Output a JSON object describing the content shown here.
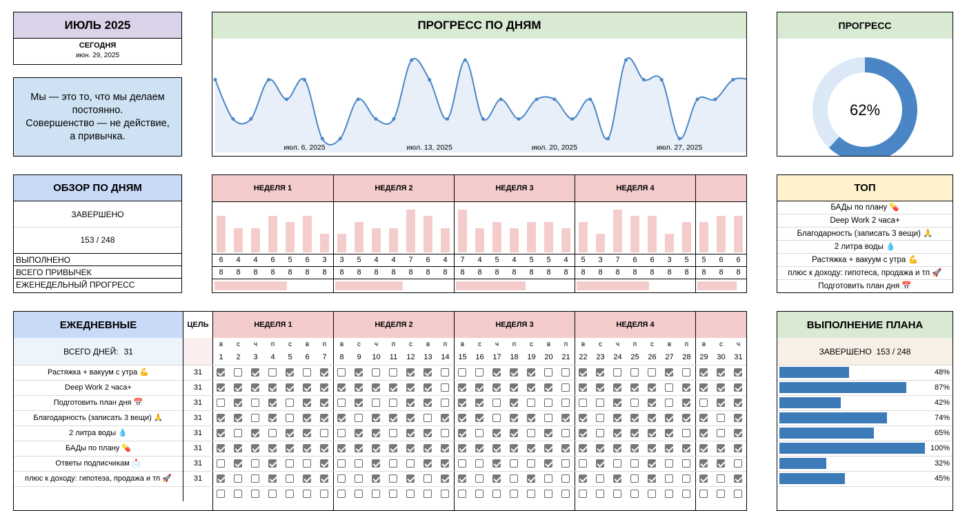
{
  "month": {
    "title": "ИЮЛЬ 2025",
    "today_label": "СЕГОДНЯ",
    "today_date": "июн. 29, 2025"
  },
  "quote": {
    "line1": "Мы — это то, что мы делаем",
    "line2": "постоянно.",
    "line3": "Совершенство — не действие,",
    "line4": "а привычка."
  },
  "progress_chart": {
    "title": "ПРОГРЕСС ПО ДНЯМ",
    "x_ticks": [
      "июл. 6, 2025",
      "июл. 13, 2025",
      "июл. 20, 2025",
      "июл. 27, 2025"
    ]
  },
  "progress": {
    "title": "ПРОГРЕСС",
    "percent_label": "62%",
    "value": 0.62
  },
  "overview": {
    "title": "ОБЗОР ПО ДНЯМ",
    "completed_label": "ЗАВЕРШЕНО",
    "completed_value": "153 / 248",
    "row_done": "ВЫПОЛНЕНО",
    "row_total": "ВСЕГО ПРИВЫЧЕК",
    "row_weekly": "ЕЖЕНЕДЕЛЬНЫЙ ПРОГРЕСС"
  },
  "weeks": [
    "НЕДЕЛЯ 1",
    "НЕДЕЛЯ 2",
    "НЕДЕЛЯ 3",
    "НЕДЕЛЯ 4"
  ],
  "chart_data": {
    "type": "line",
    "x": [
      1,
      2,
      3,
      4,
      5,
      6,
      7,
      8,
      9,
      10,
      11,
      12,
      13,
      14,
      15,
      16,
      17,
      18,
      19,
      20,
      21,
      22,
      23,
      24,
      25,
      26,
      27,
      28,
      29,
      30,
      31
    ],
    "values": [
      6,
      4,
      4,
      6,
      5,
      6,
      3,
      3,
      5,
      4,
      4,
      7,
      6,
      4,
      7,
      4,
      5,
      4,
      5,
      5,
      4,
      5,
      3,
      7,
      6,
      6,
      3,
      5,
      5,
      6,
      6
    ],
    "totals": [
      8,
      8,
      8,
      8,
      8,
      8,
      8,
      8,
      8,
      8,
      8,
      8,
      8,
      8,
      8,
      8,
      8,
      8,
      8,
      8,
      8,
      8,
      8,
      8,
      8,
      8,
      8,
      8,
      8,
      8,
      8
    ],
    "weekly_progress": [
      0.61,
      0.57,
      0.59,
      0.61,
      0.58
    ]
  },
  "top": {
    "title": "ТОП",
    "items": [
      "БАДы по плану 💊",
      "Deep Work 2 часа+",
      "Благодарность (записать 3 вещи) 🙏",
      "2 литра воды 💧",
      "Растяжка + вакуум с утра 💪",
      "плюс к доходу: гипотеса, продажа и тп 🚀",
      "Подготовить план дня 📅"
    ]
  },
  "daily": {
    "title": "ЕЖЕДНЕВНЫЕ",
    "goal_label": "ЦЕЛЬ",
    "total_days_label": "ВСЕГО ДНЕЙ:",
    "total_days_value": "31",
    "weekdays": [
      "в",
      "с",
      "ч",
      "п",
      "с",
      "в",
      "п",
      "в",
      "с",
      "ч",
      "п",
      "с",
      "в",
      "п",
      "в",
      "с",
      "ч",
      "п",
      "с",
      "в",
      "п",
      "в",
      "с",
      "ч",
      "п",
      "с",
      "в",
      "п",
      "в",
      "с",
      "ч"
    ],
    "habits": [
      {
        "name": "Растяжка + вакуум с утра 💪",
        "goal": "31",
        "pct": "48%",
        "frac": 0.48,
        "days": [
          1,
          0,
          1,
          0,
          1,
          0,
          1,
          0,
          1,
          0,
          0,
          1,
          1,
          0,
          0,
          0,
          1,
          1,
          1,
          0,
          0,
          1,
          1,
          0,
          0,
          0,
          1,
          0,
          1,
          1,
          1
        ]
      },
      {
        "name": "Deep Work 2 часа+",
        "goal": "31",
        "pct": "87%",
        "frac": 0.87,
        "days": [
          1,
          1,
          1,
          1,
          1,
          1,
          1,
          1,
          1,
          1,
          1,
          1,
          1,
          0,
          1,
          1,
          1,
          1,
          1,
          1,
          0,
          1,
          1,
          1,
          1,
          1,
          0,
          1,
          1,
          1,
          1
        ]
      },
      {
        "name": "Подготовить план дня 📅",
        "goal": "31",
        "pct": "42%",
        "frac": 0.42,
        "days": [
          0,
          1,
          0,
          1,
          0,
          1,
          1,
          0,
          1,
          0,
          0,
          1,
          1,
          0,
          1,
          1,
          0,
          1,
          0,
          0,
          0,
          0,
          0,
          1,
          0,
          1,
          0,
          1,
          0,
          1,
          1
        ]
      },
      {
        "name": "Благодарность (записать 3 вещи) 🙏",
        "goal": "31",
        "pct": "74%",
        "frac": 0.74,
        "days": [
          1,
          1,
          0,
          1,
          0,
          1,
          1,
          1,
          0,
          1,
          1,
          1,
          0,
          1,
          1,
          1,
          0,
          1,
          1,
          0,
          1,
          1,
          0,
          1,
          1,
          1,
          1,
          1,
          1,
          0,
          1
        ]
      },
      {
        "name": "2 литра воды 💧",
        "goal": "31",
        "pct": "65%",
        "frac": 0.65,
        "days": [
          1,
          0,
          1,
          0,
          1,
          1,
          0,
          0,
          1,
          1,
          0,
          1,
          1,
          0,
          1,
          0,
          1,
          1,
          0,
          1,
          0,
          1,
          0,
          1,
          1,
          1,
          1,
          0,
          1,
          0,
          1
        ]
      },
      {
        "name": "БАДы по плану 💊",
        "goal": "31",
        "pct": "100%",
        "frac": 1.0,
        "days": [
          1,
          1,
          1,
          1,
          1,
          1,
          1,
          1,
          1,
          1,
          1,
          1,
          1,
          1,
          1,
          1,
          1,
          1,
          1,
          1,
          1,
          1,
          1,
          1,
          1,
          1,
          1,
          1,
          1,
          1,
          1
        ]
      },
      {
        "name": "Ответы подписчикам 📩",
        "goal": "31",
        "pct": "32%",
        "frac": 0.32,
        "days": [
          0,
          1,
          0,
          1,
          0,
          0,
          1,
          0,
          0,
          1,
          0,
          0,
          1,
          1,
          0,
          0,
          1,
          0,
          0,
          1,
          0,
          0,
          1,
          0,
          0,
          1,
          0,
          0,
          1,
          1,
          0
        ]
      },
      {
        "name": "плюс к доходу: гипотеза, продажа и тп 🚀",
        "goal": "31",
        "pct": "45%",
        "frac": 0.45,
        "days": [
          1,
          0,
          0,
          1,
          0,
          1,
          1,
          0,
          0,
          1,
          0,
          1,
          0,
          1,
          1,
          0,
          1,
          0,
          1,
          0,
          0,
          1,
          0,
          1,
          0,
          1,
          0,
          0,
          1,
          0,
          1
        ]
      }
    ]
  },
  "plan": {
    "title": "ВЫПОЛНЕНИЕ ПЛАНА",
    "completed_label": "ЗАВЕРШЕНО",
    "completed_value": "153 / 248"
  },
  "colors": {
    "purple": "#d9d2e9",
    "blue": "#c9daf8",
    "green": "#d9ead3",
    "pink": "#f4cccc",
    "yellow": "#fff2cc",
    "line": "#4a86c5",
    "bar": "#3d7ab8"
  }
}
